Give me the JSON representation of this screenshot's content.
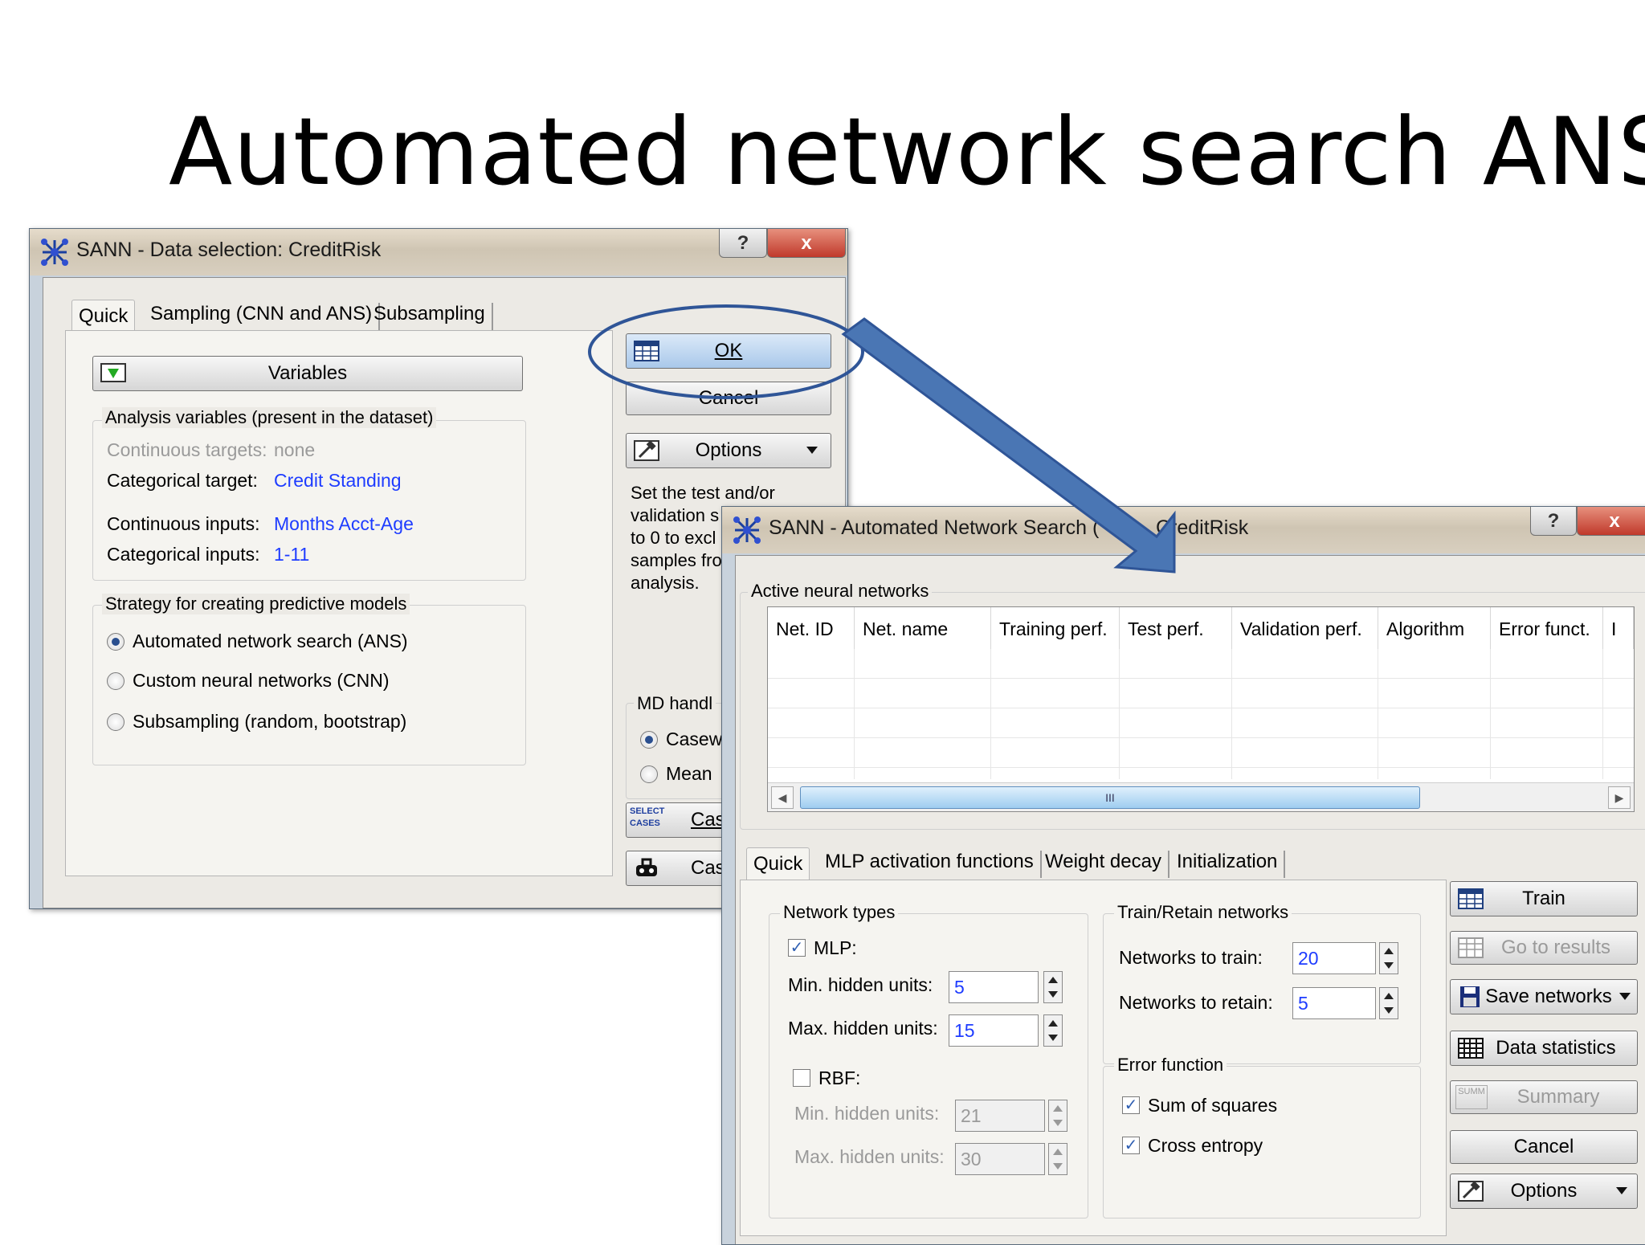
{
  "slide": {
    "title": "Automated network search ANS"
  },
  "window1": {
    "title": "SANN - Data selection: CreditRisk",
    "help_label": "?",
    "close_label": "x",
    "tabs": [
      "Quick",
      "Sampling (CNN and ANS)",
      "Subsampling"
    ],
    "variables_label": "Variables",
    "analysis_group_label": "Analysis variables (present in the dataset)",
    "cont_targets_label": "Continuous targets:",
    "cont_targets_value": "none",
    "cat_target_label": "Categorical target:",
    "cat_target_value": "Credit Standing",
    "cont_inputs_label": "Continuous inputs:",
    "cont_inputs_value": "Months Acct-Age",
    "cat_inputs_label": "Categorical inputs:",
    "cat_inputs_value": "1-11",
    "strategy_group_label": "Strategy for creating predictive models",
    "strategy_options": [
      "Automated network search (ANS)",
      "Custom neural networks (CNN)",
      "Subsampling (random, bootstrap)"
    ],
    "strategy_selected": 0,
    "ok_label": "OK",
    "cancel_label": "Cancel",
    "options_label": "Options",
    "info_lines": [
      "Set the test and/or",
      "validation s",
      "to 0 to excl",
      "samples fro",
      "analysis."
    ],
    "md_group_label": "MD handl",
    "md_options": [
      "Casew",
      "Mean"
    ],
    "select_cases_icon_text": [
      "SELECT",
      "CASES"
    ],
    "select_cases_label": "Cas",
    "cases_label": "Cas"
  },
  "window2": {
    "title": "SANN - Automated Network Search (ANS): CreditRisk",
    "title_visible": "SANN - Automated Network Search (",
    "title_tail": "CreditRisk",
    "help_label": "?",
    "close_label": "x",
    "active_group_label": "Active neural networks",
    "columns": [
      "Net. ID",
      "Net. name",
      "Training perf.",
      "Test perf.",
      "Validation perf.",
      "Algorithm",
      "Error funct.",
      "I"
    ],
    "rows": [],
    "scroll_thumb": "III",
    "tabs": [
      "Quick",
      "MLP activation functions",
      "Weight decay",
      "Initialization"
    ],
    "network_types_label": "Network types",
    "mlp_label": "MLP:",
    "mlp_checked": true,
    "mlp_min_label": "Min. hidden units:",
    "mlp_min_value": "5",
    "mlp_max_label": "Max. hidden units:",
    "mlp_max_value": "15",
    "rbf_label": "RBF:",
    "rbf_checked": false,
    "rbf_min_label": "Min. hidden units:",
    "rbf_min_value": "21",
    "rbf_max_label": "Max. hidden units:",
    "rbf_max_value": "30",
    "train_retain_label": "Train/Retain networks",
    "to_train_label": "Networks to train:",
    "to_train_value": "20",
    "to_retain_label": "Networks to retain:",
    "to_retain_value": "5",
    "error_function_label": "Error function",
    "sum_squares_label": "Sum of squares",
    "cross_entropy_label": "Cross entropy",
    "buttons": {
      "train": "Train",
      "go_to_results": "Go to results",
      "save_networks": "Save networks",
      "data_statistics": "Data statistics",
      "summary": "Summary",
      "cancel": "Cancel",
      "options": "Options"
    },
    "summary_icon_text": "SUMM"
  },
  "colors": {
    "arrow": "#4a76b4",
    "highlight_ellipse": "#2f5597",
    "value_text": "#1e3cff",
    "close_button": "#c0392b"
  }
}
